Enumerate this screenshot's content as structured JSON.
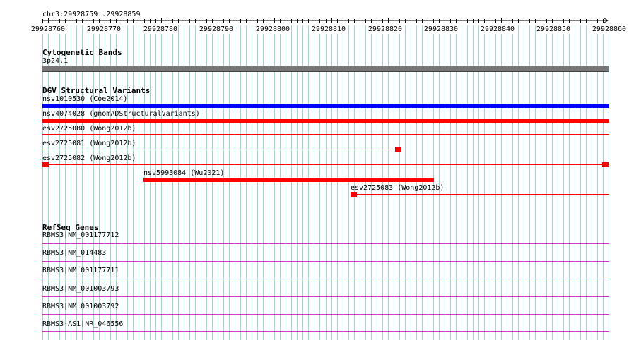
{
  "ruler": {
    "location": "chr3:29928759..29928859",
    "ticks": [
      "29928760",
      "29928770",
      "29928780",
      "29928790",
      "29928800",
      "29928810",
      "29928820",
      "29928830",
      "29928840",
      "29928850",
      "29928860"
    ]
  },
  "cytoband_track": {
    "title": "Cytogenetic Bands",
    "band_label": "3p24.1"
  },
  "dgv_track": {
    "title": "DGV Structural Variants",
    "features": [
      {
        "label": "nsv1010530 (Coe2014)",
        "color": "#0000ff"
      },
      {
        "label": "nsv4074028 (gnomADStructuralVariants)",
        "color": "#ff0000"
      },
      {
        "label": "esv2725080 (Wong2012b)",
        "color": "#ff0000"
      },
      {
        "label": "esv2725081 (Wong2012b)",
        "color": "#ff0000"
      },
      {
        "label": "esv2725082 (Wong2012b)",
        "color": "#ff0000"
      },
      {
        "label": "nsv5993084 (Wu2021)",
        "color": "#ff0000"
      },
      {
        "label": "esv2725083 (Wong2012b)",
        "color": "#ff0000"
      }
    ]
  },
  "refseq_track": {
    "title": "RefSeq Genes",
    "color": "#cc33cc",
    "genes": [
      "RBMS3|NM_001177712",
      "RBMS3|NM_014483",
      "RBMS3|NM_001177711",
      "RBMS3|NM_001003793",
      "RBMS3|NM_001003792",
      "RBMS3-AS1|NR_046556"
    ]
  },
  "colors": {
    "grid_line": "#9fd3db",
    "band_fill": "#777777",
    "variant_red": "#ff0000",
    "variant_blue": "#0000ff",
    "gene_purple": "#cc33cc"
  }
}
